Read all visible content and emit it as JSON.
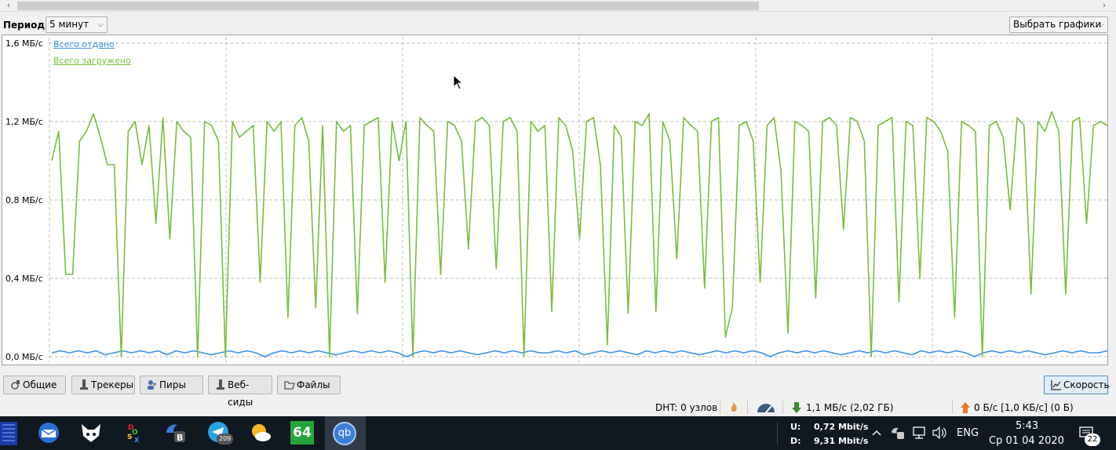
{
  "toolbar": {
    "period_label": "Период:",
    "period_value": "5 минут",
    "graphs_button": "Выбрать графики"
  },
  "chart_data": {
    "type": "line",
    "ylim": [
      0,
      1.6
    ],
    "y_ticks": [
      "1,6 МБ/с",
      "1,2 МБ/с",
      "0,8 МБ/с",
      "0,4 МБ/с",
      "0,0 МБ/с"
    ],
    "grid": true,
    "legend_position": "top-left",
    "series": [
      {
        "name": "Всего отдано",
        "color": "#3c8fde",
        "values": [
          0.02,
          0.03,
          0.02,
          0.03,
          0.02,
          0.03,
          0.01,
          0.02,
          0.03,
          0.02,
          0.03,
          0.02,
          0.03,
          0.01,
          0.03,
          0.02,
          0.03,
          0.02,
          0.01,
          0.02,
          0.03,
          0.02,
          0.03,
          0.02,
          0.0,
          0.02,
          0.03,
          0.02,
          0.03,
          0.02,
          0.03,
          0.02,
          0.01,
          0.02,
          0.03,
          0.02,
          0.03,
          0.02,
          0.03,
          0.02,
          0.0,
          0.02,
          0.03,
          0.02,
          0.03,
          0.02,
          0.03,
          0.02,
          0.01,
          0.02,
          0.03,
          0.02,
          0.03,
          0.02,
          0.03,
          0.02,
          0.02,
          0.03,
          0.02,
          0.03,
          0.01,
          0.02,
          0.03,
          0.02,
          0.03,
          0.02,
          0.01,
          0.03,
          0.02,
          0.03,
          0.02,
          0.03,
          0.02,
          0.01,
          0.02,
          0.03,
          0.02,
          0.03,
          0.02,
          0.03,
          0.02,
          0.0,
          0.02,
          0.03,
          0.02,
          0.03,
          0.02,
          0.03,
          0.02,
          0.01,
          0.02,
          0.03,
          0.02,
          0.03,
          0.02,
          0.03,
          0.02,
          0.01,
          0.03,
          0.02,
          0.03,
          0.02,
          0.03,
          0.02,
          0.0,
          0.02,
          0.03,
          0.02,
          0.03,
          0.02,
          0.03,
          0.02,
          0.01,
          0.02,
          0.03,
          0.02,
          0.03,
          0.02,
          0.02,
          0.03
        ]
      },
      {
        "name": "Всего загружено",
        "color": "#78bc3c",
        "values": [
          1.0,
          1.15,
          0.42,
          0.42,
          1.1,
          1.15,
          1.24,
          1.12,
          0.98,
          0.98,
          0.0,
          1.15,
          1.2,
          0.98,
          1.18,
          0.68,
          1.22,
          0.6,
          1.2,
          1.15,
          1.12,
          0.0,
          1.2,
          1.18,
          1.1,
          0.0,
          1.2,
          1.12,
          1.15,
          1.18,
          0.38,
          1.2,
          1.15,
          1.2,
          0.2,
          1.18,
          1.22,
          1.1,
          0.25,
          1.18,
          0.0,
          1.2,
          1.15,
          1.18,
          0.22,
          1.18,
          1.2,
          1.22,
          0.38,
          1.2,
          1.0,
          1.2,
          0.0,
          1.22,
          1.18,
          1.15,
          0.42,
          1.2,
          1.18,
          1.1,
          0.55,
          1.2,
          1.22,
          1.18,
          0.45,
          1.2,
          1.22,
          1.15,
          0.0,
          1.2,
          1.15,
          1.18,
          0.23,
          1.22,
          1.18,
          1.05,
          0.6,
          1.2,
          1.22,
          0.98,
          0.06,
          1.18,
          1.12,
          0.22,
          1.2,
          1.18,
          1.24,
          0.23,
          1.2,
          1.1,
          0.5,
          1.22,
          1.18,
          1.15,
          0.35,
          1.2,
          1.22,
          0.1,
          0.25,
          1.18,
          1.2,
          1.1,
          0.38,
          1.18,
          1.22,
          0.95,
          0.12,
          1.2,
          1.18,
          1.15,
          0.3,
          1.2,
          1.22,
          1.18,
          0.65,
          1.22,
          1.2,
          1.1,
          0.0,
          1.18,
          1.2,
          1.22,
          0.28,
          1.2,
          1.18,
          0.4,
          1.22,
          1.2,
          1.15,
          1.05,
          0.2,
          1.2,
          1.18,
          1.15,
          0.0,
          1.18,
          1.2,
          1.12,
          0.75,
          1.22,
          1.18,
          0.32,
          1.2,
          1.15,
          1.25,
          1.15,
          0.32,
          1.2,
          1.22,
          0.68,
          1.18,
          1.2,
          1.18
        ]
      }
    ]
  },
  "tabs": [
    {
      "label": "Общие"
    },
    {
      "label": "Трекеры"
    },
    {
      "label": "Пиры"
    },
    {
      "label": "Веб-сиды"
    },
    {
      "label": "Файлы"
    },
    {
      "label": "Скорость"
    }
  ],
  "statusbar": {
    "dht": "DHT: 0 узлов",
    "download": "1,1 МБ/с (2,02 ГБ)",
    "upload": "0 Б/с [1,0 КБ/с] (0 Б)"
  },
  "taskbar": {
    "net_u_label": "U:",
    "net_u_value": "0,72 Mbit/s",
    "net_d_label": "D:",
    "net_d_value": "9,31 Mbit/s",
    "lang": "ENG",
    "time": "5:43",
    "date": "Ср 01 04 2020",
    "telegram_badge": "209",
    "notifications": "22",
    "app_label_aida": "64",
    "app_label_qbit": "qb"
  },
  "colors": {
    "upload_series": "#3c8fde",
    "download_series": "#78bc3c",
    "taskbar_bg": "#101820"
  }
}
